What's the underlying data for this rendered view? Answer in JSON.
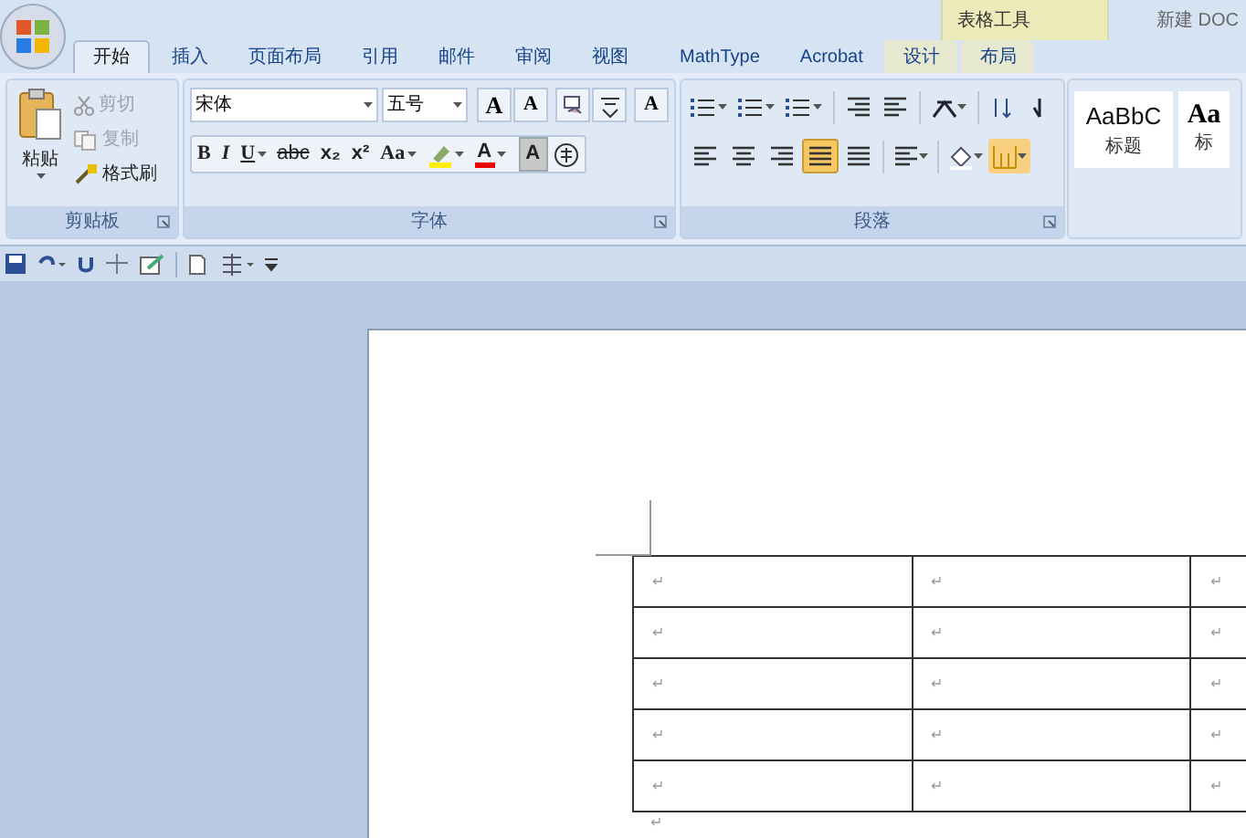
{
  "window": {
    "contextual_group": "表格工具",
    "title": "新建 DOC"
  },
  "tabs": [
    {
      "label": "开始",
      "selected": true
    },
    {
      "label": "插入",
      "selected": false
    },
    {
      "label": "页面布局",
      "selected": false
    },
    {
      "label": "引用",
      "selected": false
    },
    {
      "label": "邮件",
      "selected": false
    },
    {
      "label": "审阅",
      "selected": false
    },
    {
      "label": "视图",
      "selected": false
    },
    {
      "label": "MathType",
      "selected": false
    },
    {
      "label": "Acrobat",
      "selected": false
    },
    {
      "label": "设计",
      "selected": false,
      "contextual": true
    },
    {
      "label": "布局",
      "selected": false,
      "contextual": true
    }
  ],
  "clipboard": {
    "paste": "粘贴",
    "label": "剪贴板",
    "items": [
      {
        "kind": "cut",
        "label": "剪切",
        "disabled": true
      },
      {
        "kind": "copy",
        "label": "复制",
        "disabled": true
      },
      {
        "kind": "painter",
        "label": "格式刷",
        "disabled": false
      }
    ]
  },
  "font": {
    "name": "宋体",
    "size": "五号",
    "label": "字体",
    "row1": [
      {
        "kind": "grow",
        "label": "A"
      },
      {
        "kind": "shrink",
        "label": "A"
      },
      {
        "kind": "clear"
      },
      {
        "kind": "phonetic"
      },
      {
        "kind": "border",
        "label": "A"
      }
    ],
    "row2": [
      {
        "kind": "bold",
        "label": "B"
      },
      {
        "kind": "italic",
        "label": "I"
      },
      {
        "kind": "underline",
        "label": "U",
        "dropdown": true
      },
      {
        "kind": "strike",
        "label": "abc"
      },
      {
        "kind": "sub",
        "label": "x₂"
      },
      {
        "kind": "sup",
        "label": "x²"
      },
      {
        "kind": "case",
        "label": "Aa",
        "dropdown": true
      },
      {
        "kind": "highlight",
        "dropdown": true
      },
      {
        "kind": "color",
        "label": "A",
        "dropdown": true
      },
      {
        "kind": "shade",
        "label": "A"
      },
      {
        "kind": "enclose"
      }
    ]
  },
  "paragraph": {
    "label": "段落",
    "alignment": [
      {
        "selected": false
      },
      {
        "selected": false
      },
      {
        "selected": false
      },
      {
        "selected": true
      },
      {
        "selected": false
      }
    ],
    "borders_active": true
  },
  "styles": [
    {
      "sample": "AaBbC",
      "name": "标题"
    },
    {
      "sample": "Aa",
      "name": "标"
    }
  ],
  "table": {
    "rows": [
      [
        "↵",
        "↵",
        "↵"
      ],
      [
        "↵",
        "↵",
        "↵"
      ],
      [
        "↵",
        "↵",
        "↵"
      ],
      [
        "↵",
        "↵",
        "↵"
      ],
      [
        "↵",
        "↵",
        "↵"
      ]
    ]
  },
  "after_table": "↵"
}
